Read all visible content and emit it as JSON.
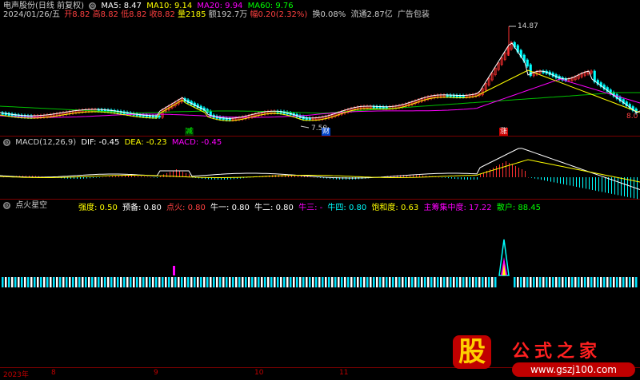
{
  "header": {
    "stock_name": "电声股份(日线 前复权)",
    "ma": [
      {
        "label": "MA5: 8.47",
        "color": "#ffffff"
      },
      {
        "label": "MA10: 9.14",
        "color": "#ffff00"
      },
      {
        "label": "MA20: 9.94",
        "color": "#ff00ff"
      },
      {
        "label": "MA60: 9.76",
        "color": "#00ff00"
      }
    ],
    "quote": {
      "date": "2024/01/26/五",
      "open": "开8.82",
      "high": "高8.82",
      "low": "低8.82",
      "close": "收8.82",
      "volume": "量2185",
      "amount": "额192.7万",
      "change": "幅0.20(2.32%)",
      "turnover": "换0.08%",
      "float_cap": "流通2.87亿",
      "ad_label": "广告包装"
    }
  },
  "price_panel": {
    "high_label": "14.87",
    "low_label": "7.50",
    "right_label": "8.0",
    "events": [
      {
        "text": "减",
        "color": "#00ff00",
        "bg": "#003300"
      },
      {
        "text": "财",
        "color": "#ffffff",
        "bg": "#0044cc"
      },
      {
        "text": "涨",
        "color": "#ffffff",
        "bg": "#cc0000"
      }
    ]
  },
  "macd_panel": {
    "title": "MACD(12,26,9)",
    "dif": "DIF: -0.45",
    "dea": "DEA: -0.23",
    "macd": "MACD: -0.45",
    "colors": {
      "dif": "#ffffff",
      "dea": "#ffff00",
      "macd": "#ff00ff"
    }
  },
  "indicator_panel": {
    "title": "点火星空",
    "items": [
      {
        "label": "强度: 0.50",
        "color": "#ffff00"
      },
      {
        "label": "预备: 0.80",
        "color": "#ffffff"
      },
      {
        "label": "点火: 0.80",
        "color": "#ff4040"
      },
      {
        "label": "牛一: 0.80",
        "color": "#ffffff"
      },
      {
        "label": "牛二: 0.80",
        "color": "#ffffff"
      },
      {
        "label": "牛三: -",
        "color": "#ff00ff"
      },
      {
        "label": "牛四: 0.80",
        "color": "#00ffff"
      },
      {
        "label": "饱和度: 0.63",
        "color": "#ffff00"
      },
      {
        "label": "主筹集中度: 17.22",
        "color": "#ff00ff"
      },
      {
        "label": "散户: 88.45",
        "color": "#00ff00"
      }
    ]
  },
  "time_axis": {
    "labels": [
      "2023年",
      "8",
      "9",
      "10",
      "11"
    ]
  },
  "watermark": {
    "text": "公式之家",
    "url": "www.gszj100.com",
    "glyph": "股"
  }
}
